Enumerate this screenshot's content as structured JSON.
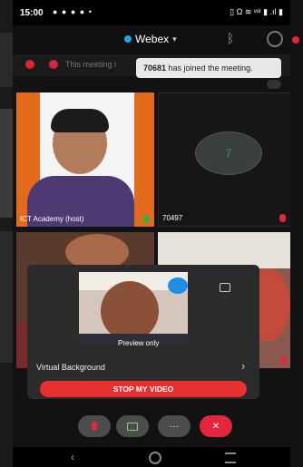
{
  "status_bar": {
    "time": "15:00",
    "left_icons": "● ● ● ● •",
    "right_icons": "▯ Ω ≋ ᵛᵒˡ ▮ .ıl ▮"
  },
  "header": {
    "app_title": "Webex"
  },
  "notice": {
    "text": "This meeting i"
  },
  "toast": {
    "user_id": "70681",
    "message": " has joined the meeting."
  },
  "tiles": [
    {
      "label": "ICT Academy (host)"
    },
    {
      "label": "70497",
      "avatar_initial": "7"
    },
    {
      "label": ""
    },
    {
      "label": ""
    }
  ],
  "preview_panel": {
    "preview_text": "Preview only",
    "virtual_background_label": "Virtual Background",
    "stop_video_label": "STOP MY VIDEO"
  },
  "controls": {
    "more_label": "···",
    "end_label": "✕"
  },
  "colors": {
    "accent_blue": "#1aa6e8",
    "danger_red": "#e8302e",
    "mic_green": "#27b24a"
  }
}
